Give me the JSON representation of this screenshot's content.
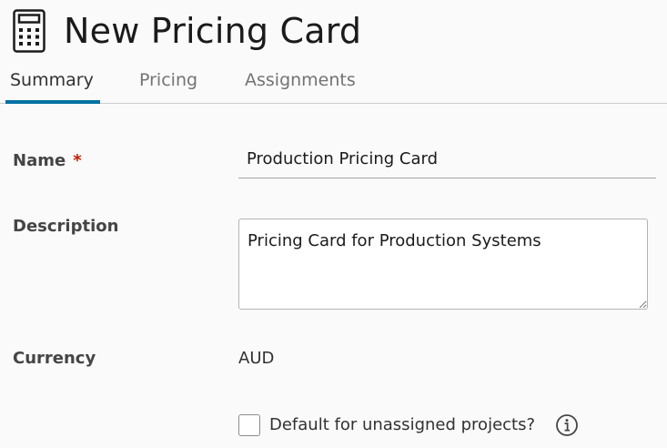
{
  "header": {
    "title": "New Pricing Card",
    "icon": "calculator-icon"
  },
  "tabs": [
    {
      "label": "Summary",
      "active": true
    },
    {
      "label": "Pricing",
      "active": false
    },
    {
      "label": "Assignments",
      "active": false
    }
  ],
  "form": {
    "name": {
      "label": "Name",
      "required_marker": "*",
      "value": "Production Pricing Card"
    },
    "description": {
      "label": "Description",
      "value": "Pricing Card for Production Systems"
    },
    "currency": {
      "label": "Currency",
      "value": "AUD"
    },
    "default_checkbox": {
      "label": "Default for unassigned projects?",
      "checked": false,
      "info_icon": "info-icon"
    }
  },
  "colors": {
    "accent": "#0072a3",
    "required": "#c21d00"
  }
}
